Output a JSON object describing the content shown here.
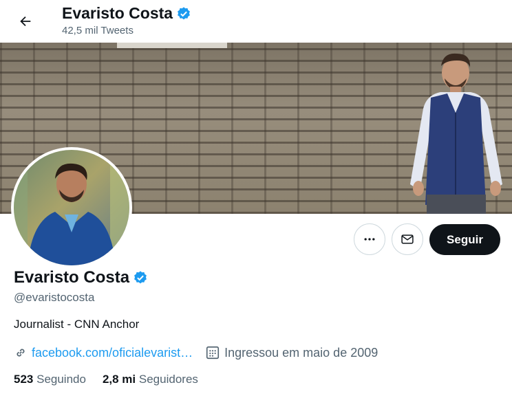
{
  "header": {
    "name": "Evaristo Costa",
    "tweet_count": "42,5 mil Tweets"
  },
  "profile": {
    "name": "Evaristo Costa",
    "handle": "@evaristocosta",
    "bio": "Journalist - CNN Anchor",
    "link_text": "facebook.com/oficialevarist…",
    "joined": "Ingressou em maio de 2009",
    "following_count": "523",
    "following_label": "Seguindo",
    "followers_count": "2,8 mi",
    "followers_label": "Seguidores"
  },
  "actions": {
    "follow_label": "Seguir",
    "more_icon": "more-icon",
    "message_icon": "envelope-icon"
  },
  "colors": {
    "accent": "#1d9bf0",
    "text": "#0f1419",
    "muted": "#536471",
    "follow_bg": "#0f1419"
  }
}
